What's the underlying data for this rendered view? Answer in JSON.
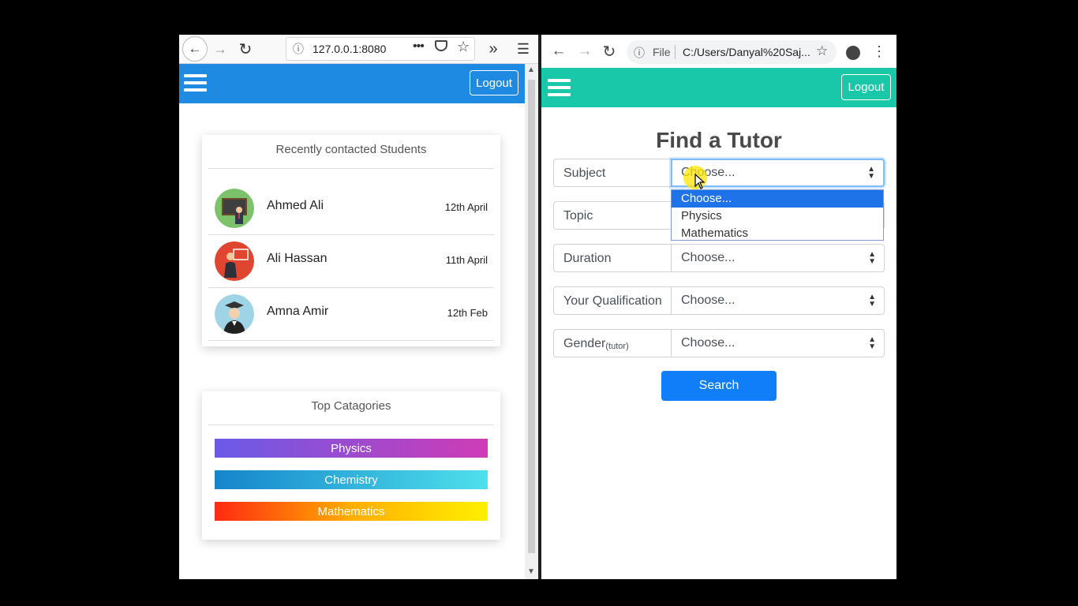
{
  "left_browser": {
    "url": "127.0.0.1:8080",
    "logout_label": "Logout",
    "recent_card": {
      "title": "Recently contacted Students",
      "students": [
        {
          "name": "Ahmed Ali",
          "date": "12th April"
        },
        {
          "name": "Ali Hassan",
          "date": "11th April"
        },
        {
          "name": "Amna Amir",
          "date": "12th Feb"
        }
      ]
    },
    "categories_card": {
      "title": "Top Catagories",
      "items": [
        {
          "label": "Physics"
        },
        {
          "label": "Chemistry"
        },
        {
          "label": "Mathematics"
        }
      ]
    },
    "navbar_color": "#1e8ae2"
  },
  "right_browser": {
    "file_label": "File",
    "url": "C:/Users/Danyal%20Saj...",
    "logout_label": "Logout",
    "navbar_color": "#19c8a9",
    "page_title": "Find a Tutor",
    "form": {
      "fields": [
        {
          "label": "Subject",
          "value": "Choose..."
        },
        {
          "label": "Topic",
          "value": ""
        },
        {
          "label": "Duration",
          "value": "Choose..."
        },
        {
          "label": "Your Qualification",
          "value": "Choose..."
        },
        {
          "label": "Gender",
          "label_sub": "(tutor)",
          "value": "Choose..."
        }
      ],
      "subject_dropdown_options": [
        "Choose...",
        "Physics",
        "Mathematics"
      ],
      "search_label": "Search"
    }
  }
}
